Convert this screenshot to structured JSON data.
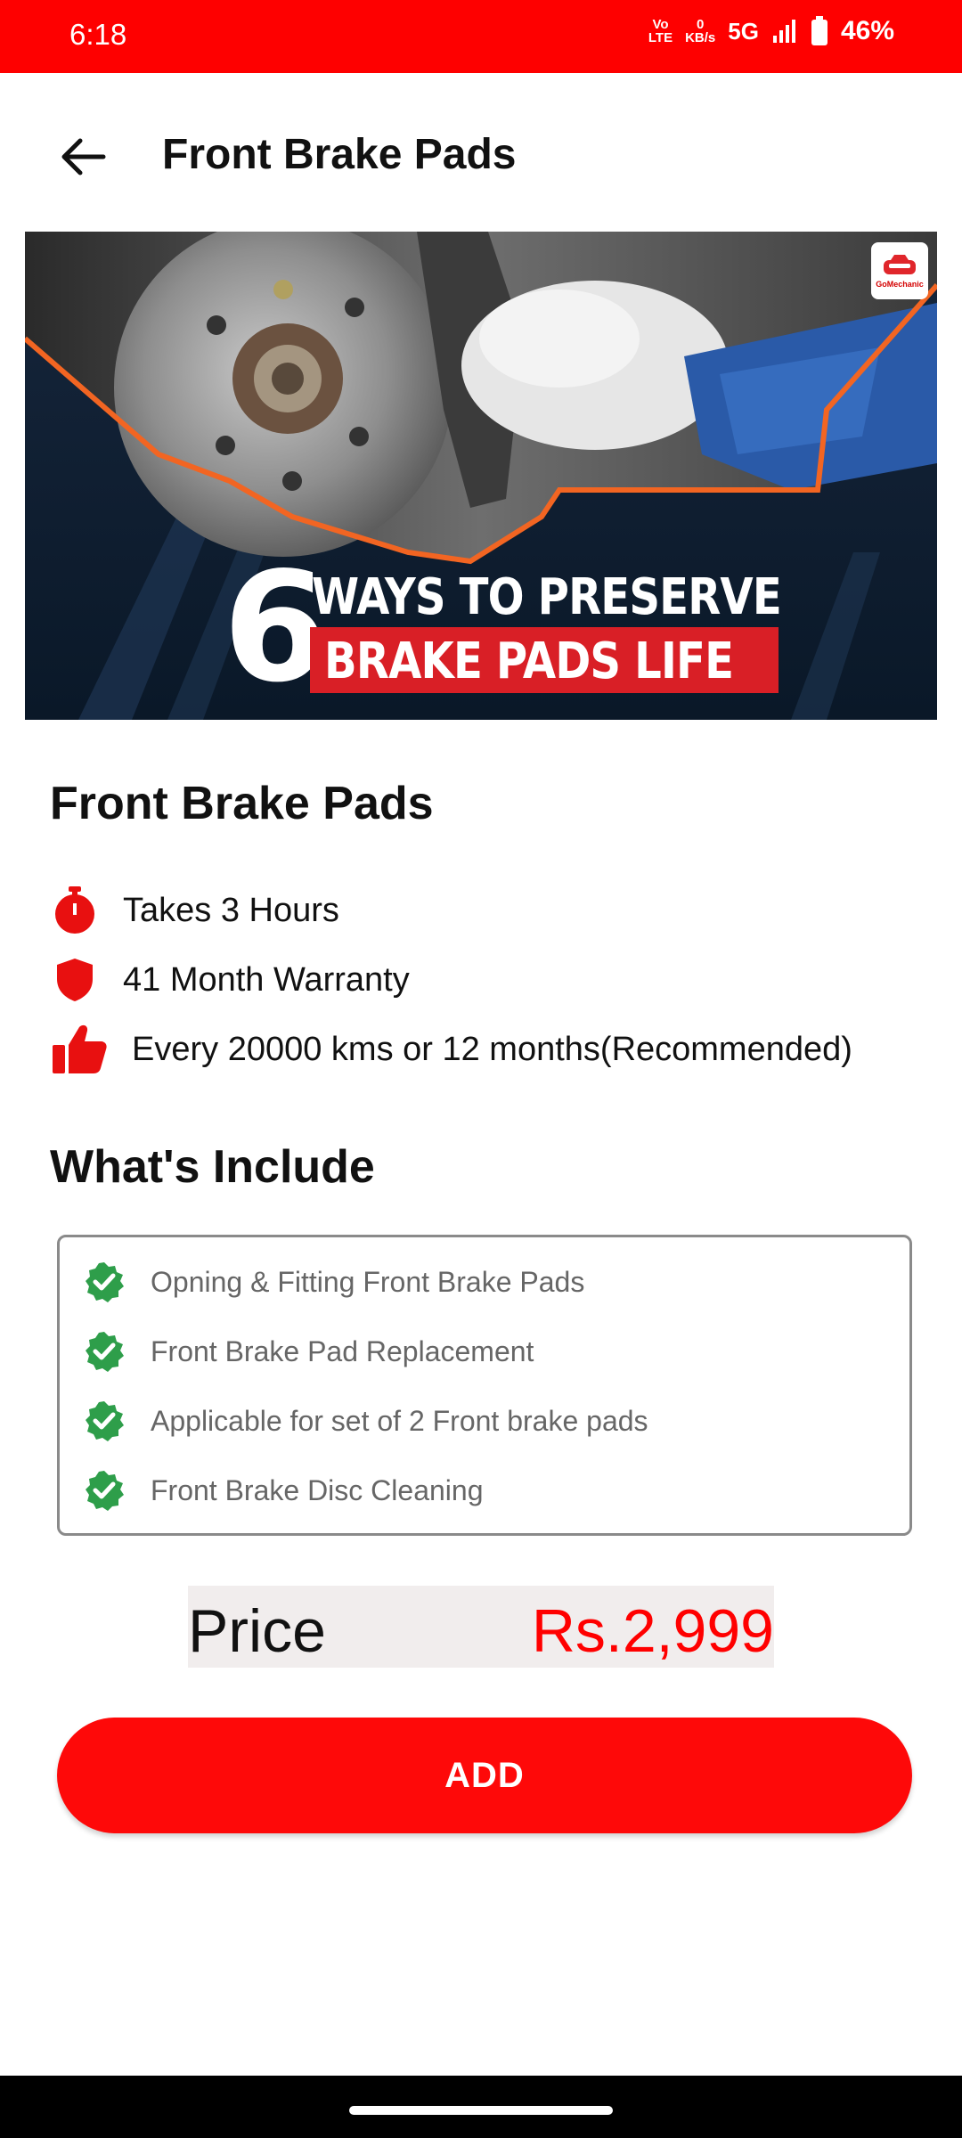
{
  "status_bar": {
    "time": "6:18",
    "network_top": "Vo",
    "network_bottom": "LTE",
    "data_speed_value": "0",
    "data_speed_unit": "KB/s",
    "network_type": "5G",
    "battery": "46%"
  },
  "app_bar": {
    "title": "Front Brake Pads",
    "back_icon": "arrow-left-icon"
  },
  "banner": {
    "number": "6",
    "line1": "WAYS TO PRESERVE",
    "line2": "BRAKE PADS LIFE",
    "logo_text": "GoMechanic"
  },
  "service": {
    "title": "Front Brake Pads",
    "info": [
      {
        "icon": "stopwatch-icon",
        "text": "Takes 3 Hours"
      },
      {
        "icon": "shield-icon",
        "text": "41 Month Warranty"
      },
      {
        "icon": "thumbs-up-icon",
        "text": "Every 20000 kms or 12 months(Recommended)"
      }
    ]
  },
  "includes": {
    "title": "What's Include",
    "items": [
      "Opning & Fitting Front Brake Pads",
      "Front Brake Pad Replacement",
      "Applicable for set of 2 Front brake pads",
      "Front Brake Disc Cleaning"
    ]
  },
  "price": {
    "label": "Price",
    "value": "Rs.2,999"
  },
  "add_button": {
    "label": "ADD"
  },
  "colors": {
    "accent": "#fe0000",
    "check_green": "#2e9e4a",
    "price_red": "#ff0000"
  }
}
